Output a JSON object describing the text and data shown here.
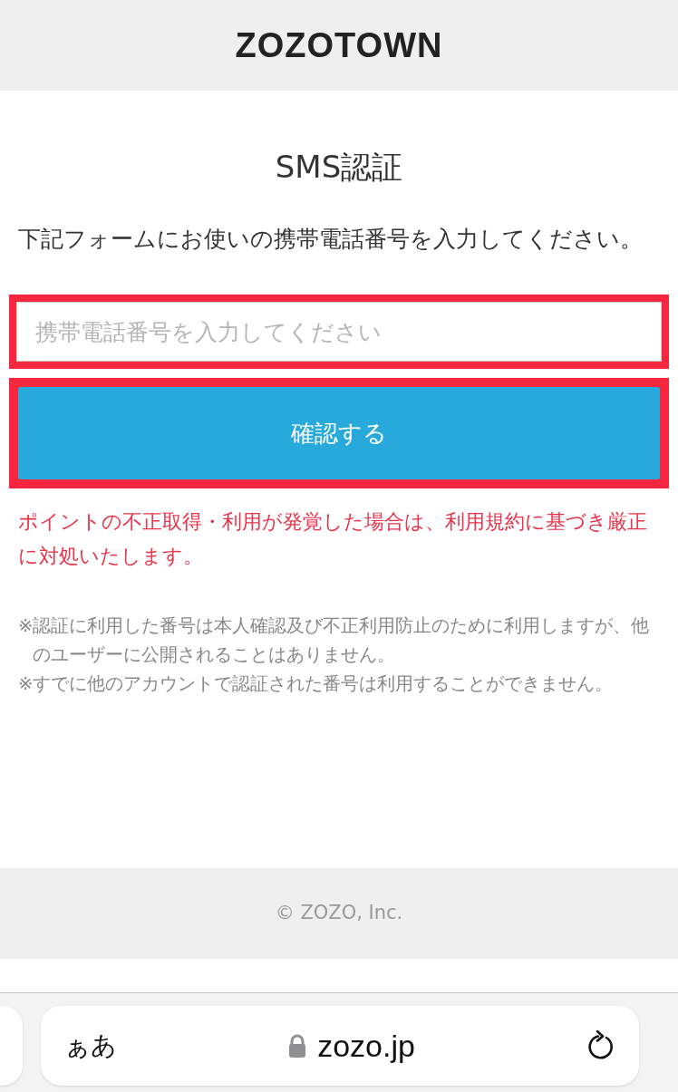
{
  "header": {
    "logo": "ZOZOTOWN"
  },
  "title": "SMS認証",
  "intro": "下記フォームにお使いの携帯電話番号を入力してください。",
  "phone_field": {
    "placeholder": "携帯電話番号を入力してください",
    "highlighted": true
  },
  "confirm_button": {
    "label": "確認する",
    "highlighted": true
  },
  "warning": "ポイントの不正取得・利用が発覚した場合は、利用規約に基づき厳正に対処いたします。",
  "notes": [
    {
      "mark": "※",
      "text": "認証に利用した番号は本人確認及び不正利用防止のために利用しますが、他のユーザーに公開されることはありません。"
    },
    {
      "mark": "※",
      "text": "すでに他のアカウントで認証された番号は利用することができません。"
    }
  ],
  "footer": {
    "copyright": "© ZOZO, Inc."
  },
  "browser_bar": {
    "text_size": "ぁあ",
    "url": "zozo.jp"
  }
}
